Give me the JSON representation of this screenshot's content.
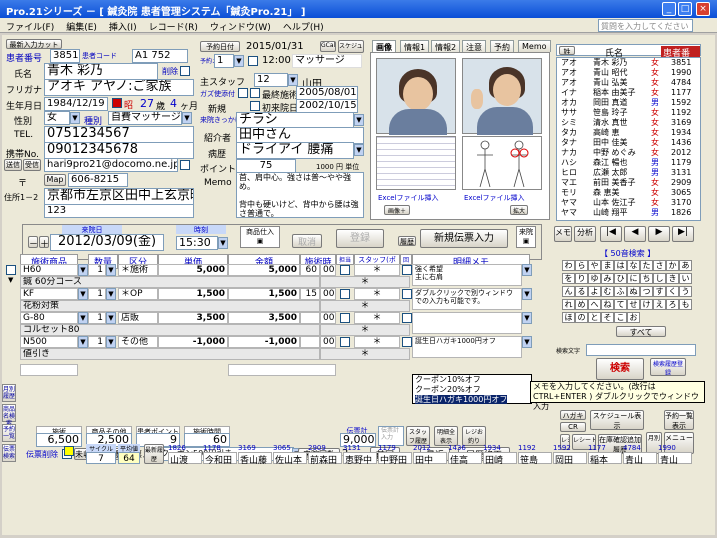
{
  "window": {
    "title": "Pro.21シリーズ － [ 鍼灸院 患者管理システム「鍼灸Pro.21」 ]"
  },
  "menu": [
    "ファイル(F)",
    "編集(E)",
    "挿入(I)",
    "レコード(R)",
    "ウィンドウ(W)",
    "ヘルプ(H)"
  ],
  "help_placeholder": "質問を入力してください",
  "patient": {
    "header_btn": "最新入力カット",
    "num_label": "患者番号",
    "num": "3851",
    "code_label": "患者コード",
    "code": "A1 752",
    "name_label": "氏名",
    "name": "青木 彩乃",
    "furigana_label": "フリガナ",
    "furigana": "アオキ アヤノ:ご家族",
    "birth_label": "生年月日",
    "birth": "1984/12/19",
    "age_s": "昭",
    "age": "27",
    "age_unit1": "歳",
    "age_m": "4",
    "age_unit2": "ヶ月",
    "sex_label": "性別",
    "sex": "女",
    "kind_label": "種別",
    "kind": "自費マッサージ",
    "tel_label": "TEL.",
    "tel": "0751234567",
    "mobile_label": "携帯No.",
    "mobile": "09012345678",
    "mail": "hari9pro21@docomo.ne.jp",
    "zip_label": "〒",
    "zip": "606-8215",
    "addr_label": "住所1－2",
    "addr1": "京都市左京区田中上玄京町",
    "addr2": "123",
    "reserve_btn": "予約日付",
    "reserve_date": "2015/01/31",
    "reserve_time": "12:00",
    "reserve_menu": "マッサージ",
    "staff_label": "主スタッフ",
    "staff_no": "12",
    "staff": "山田",
    "last_label": "最終施術",
    "last": "2005/08/01",
    "first_label": "初来院日",
    "first": "2002/10/15",
    "trigger_label": "来院きっかけ",
    "trigger": "チラシ",
    "intro_label": "紹介者",
    "intro": "田中さん",
    "disease_label": "病歴",
    "disease": "ドライアイ 腰痛",
    "point_label": "ポイント",
    "point": "75",
    "point_unit": "1000 円 単位",
    "memo_label": "Memo",
    "memo": "首、肩中心。強さは普～やや強め。\n\n背中も硬いけど、背中から腰は強さ普通で。"
  },
  "tabs": [
    "画像",
    "情報1",
    "情報2",
    "注意",
    "予約",
    "Memo"
  ],
  "excel_btn": "Excelファイル挿入",
  "visit": {
    "date_label": "来院日",
    "date": "2012/03/09",
    "dow": "(金)",
    "time_label": "時刻",
    "time": "15:30",
    "product_label": "商品仕入",
    "cancel": "取消",
    "register": "登録",
    "history": "履歴",
    "new_btn": "新規伝票入力",
    "karte": "来院"
  },
  "grid_headers": [
    "施術商品",
    "数量",
    "区分",
    "単価",
    "金額",
    "施術時間",
    "担当",
    "スタッフ(ポイント)",
    "回",
    "明細メモ"
  ],
  "rows": [
    {
      "item": "H60",
      "qty": "1",
      "cat": "＊施術",
      "price": "5,000",
      "amount": "5,000",
      "time": "60",
      "min": "00",
      "memo": "強く希望\n主に右肩",
      "sub": "鍼 60分コース"
    },
    {
      "item": "KF",
      "qty": "1",
      "cat": "＊OP",
      "price": "1,500",
      "amount": "1,500",
      "time": "15",
      "min": "00",
      "memo": "ダブルクリックで別ウィンドウでの入力も可能です。",
      "sub": "花粉対策"
    },
    {
      "item": "G-80",
      "qty": "1",
      "cat": "店販",
      "price": "3,500",
      "amount": "3,500",
      "time": "",
      "min": "00",
      "memo": "",
      "sub": "コルセット80"
    },
    {
      "item": "N500",
      "qty": "1",
      "cat": "その他",
      "price": "-1,000",
      "amount": "-1,000",
      "time": "",
      "min": "00",
      "memo": "誕生日ハガキ1000円オフ",
      "sub": "値引き"
    }
  ],
  "coupons": [
    "クーポン10%オフ",
    "クーポン20%オフ",
    "誕生日ハガキ1000円オフ"
  ],
  "tooltip": "メモを入力してください。(改行は CTRL+ENTER ) ダブルクリックでウィンドウ入力",
  "totals": {
    "t_label": "施術",
    "t": "6,500",
    "g_label": "商品その他",
    "g": "2,500",
    "p_label": "患者ポイント",
    "p": "9",
    "tm_label": "施術時間",
    "tm": "60",
    "sum_label": "伝票計",
    "sum": "9,000",
    "input_label": "伝票計入力"
  },
  "footer_btns": [
    "スタッフ履歴",
    "明細全表示",
    "レジお釣り"
  ],
  "footer2": {
    "del": "伝票削除",
    "list": "未収伝票一覧",
    "memo_label": "伝票メモ",
    "memo": "クーポン500円引き",
    "count_label": "来院回数",
    "count": "2",
    "prev": "前回",
    "recent": "最近",
    "hist": "履歴修正"
  },
  "right": {
    "headers": [
      "姓",
      "氏名",
      "患者番号"
    ],
    "list": [
      {
        "k": "アオ",
        "n": "青木 彩乃",
        "s": "女",
        "id": "3851"
      },
      {
        "k": "アオ",
        "n": "青山 昭代",
        "s": "女",
        "id": "1990"
      },
      {
        "k": "アオ",
        "n": "青山 弘美",
        "s": "女",
        "id": "4784"
      },
      {
        "k": "イナ",
        "n": "稲本 由美子",
        "s": "女",
        "id": "1177"
      },
      {
        "k": "オカ",
        "n": "岡田 真道",
        "s": "男",
        "id": "1592"
      },
      {
        "k": "ササ",
        "n": "笹島 玲子",
        "s": "女",
        "id": "1192"
      },
      {
        "k": "シミ",
        "n": "清水 真世",
        "s": "女",
        "id": "3169"
      },
      {
        "k": "タカ",
        "n": "高崎 恵",
        "s": "女",
        "id": "1934"
      },
      {
        "k": "タナ",
        "n": "田中 佳美",
        "s": "女",
        "id": "1436"
      },
      {
        "k": "ナカ",
        "n": "中野 めぐみ",
        "s": "女",
        "id": "2012"
      },
      {
        "k": "ハシ",
        "n": "森江 暢也",
        "s": "男",
        "id": "1179"
      },
      {
        "k": "ヒロ",
        "n": "広瀬 太郎",
        "s": "男",
        "id": "3131"
      },
      {
        "k": "マエ",
        "n": "前田 美香子",
        "s": "女",
        "id": "2909"
      },
      {
        "k": "モリ",
        "n": "森 恵美",
        "s": "女",
        "id": "3065"
      },
      {
        "k": "ヤマ",
        "n": "山本 佐江子",
        "s": "女",
        "id": "3170"
      },
      {
        "k": "ヤマ",
        "n": "山崎 翔平",
        "s": "男",
        "id": "1826"
      }
    ],
    "nav": [
      "メモ",
      "分析",
      "|◀",
      "◀",
      "▶",
      "▶|"
    ],
    "kana_title": "【 50音検索 】",
    "kana": [
      "わ",
      "ら",
      "や",
      "ま",
      "は",
      "な",
      "た",
      "さ",
      "か",
      "あ",
      "を",
      "り",
      "ゆ",
      "み",
      "ひ",
      "に",
      "ち",
      "し",
      "き",
      "い",
      "ん",
      "る",
      "よ",
      "む",
      "ふ",
      "ぬ",
      "つ",
      "す",
      "く",
      "う",
      "れ",
      "め",
      "へ",
      "ね",
      "て",
      "せ",
      "け",
      "え",
      "ろ",
      "も",
      "ほ",
      "の",
      "と",
      "そ",
      "こ",
      "お"
    ],
    "all": "すべて",
    "search_label": "検索文字",
    "search_btn": "検索",
    "rireki": "検索履歴登録",
    "btns": [
      "ハガキ",
      "スケジュール表示",
      "予約一覧表示",
      "CR",
      "OR",
      "レジ",
      "レシート",
      "在庫確認追加履歴",
      "メニュー",
      "月別",
      "日計"
    ]
  },
  "side": [
    "月別履歴",
    "商品名検索",
    "予約一覧",
    "伝票検索"
  ],
  "bottom": {
    "cycle_label": "サイクル",
    "cycle": "7",
    "avg_label": "平均値",
    "avg": "64",
    "btn": "最新履歴",
    "ids": [
      "1826",
      "1178",
      "3169",
      "3065",
      "2909",
      "3131",
      "1179",
      "2012",
      "1436",
      "1934",
      "1192",
      "1592",
      "1177",
      "4784",
      "1990"
    ],
    "names": [
      "山渡",
      "今和田",
      "香山藤",
      "佐山本",
      "前森田",
      "恵野中",
      "中野田",
      "田中",
      "佳高",
      "田崎",
      "笹島",
      "岡田",
      "稲本",
      "青山",
      "青山"
    ]
  }
}
